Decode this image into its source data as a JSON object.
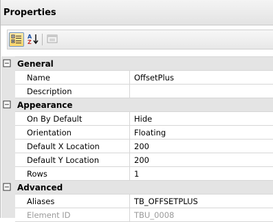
{
  "panel": {
    "title": "Properties"
  },
  "toolbar": {
    "categorized_icon": "categorized-view-icon",
    "alphabetical_icon": "sort-alphabetical-icon",
    "pages_icon": "property-pages-icon"
  },
  "categories": [
    {
      "name": "General",
      "rows": [
        {
          "name": "Name",
          "value": "OffsetPlus"
        },
        {
          "name": "Description",
          "value": ""
        }
      ]
    },
    {
      "name": "Appearance",
      "rows": [
        {
          "name": "On By Default",
          "value": "Hide"
        },
        {
          "name": "Orientation",
          "value": "Floating"
        },
        {
          "name": "Default X Location",
          "value": "200"
        },
        {
          "name": "Default Y Location",
          "value": "200"
        },
        {
          "name": "Rows",
          "value": "1"
        }
      ]
    },
    {
      "name": "Advanced",
      "rows": [
        {
          "name": "Aliases",
          "value": "TB_OFFSETPLUS"
        },
        {
          "name": "Element ID",
          "value": "TBU_0008",
          "disabled": true
        }
      ]
    }
  ],
  "colors": {
    "category_bg": "#e4e4e4",
    "grid_line": "#d6d6d6",
    "disabled_text": "#9a9a9a"
  }
}
